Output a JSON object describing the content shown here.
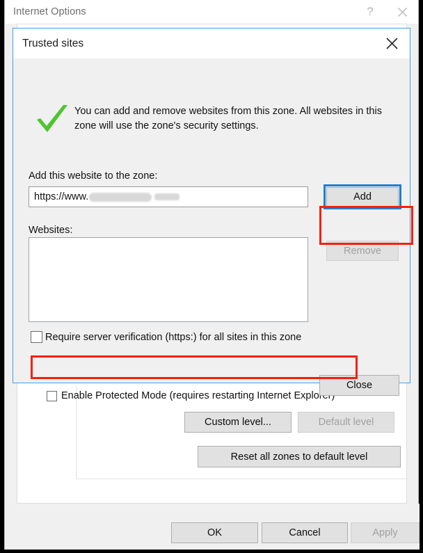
{
  "internet_options": {
    "title": "Internet Options",
    "titlebar_buttons": [
      {
        "name": "help-button",
        "glyph": "?"
      },
      {
        "name": "close-button",
        "glyph": "✕"
      }
    ],
    "protected_mode": {
      "label": "Enable Protected Mode (requires restarting Internet Explorer)",
      "checked": false
    },
    "buttons": {
      "custom_level": "Custom level...",
      "default_level": "Default level",
      "reset_zones": "Reset all zones to default level",
      "ok": "OK",
      "cancel": "Cancel",
      "apply": "Apply"
    },
    "disabled_buttons": [
      "Default level",
      "Apply"
    ]
  },
  "trusted_sites": {
    "title": "Trusted sites",
    "close_icon": "close-icon",
    "banner": {
      "icon": "green-checkmark-icon",
      "text": "You can add and remove websites from this zone. All websites in this zone will use the zone's security settings."
    },
    "add_website": {
      "label": "Add this website to the zone:",
      "value": "https://www.",
      "value_redacted": true,
      "placeholder": ""
    },
    "websites": {
      "label": "Websites:",
      "items": []
    },
    "buttons": {
      "add": "Add",
      "remove": "Remove",
      "close": "Close"
    },
    "disabled_buttons": [
      "Remove"
    ],
    "focused_button": "Add",
    "require_https": {
      "label": "Require server verification (https:) for all sites in this zone",
      "checked": false
    }
  },
  "annotations": {
    "color": "#f81f09",
    "highlights": [
      "add-button",
      "require-server-verification-checkbox"
    ]
  },
  "colors": {
    "accent_blue": "#3da0ef",
    "focus_blue": "#1f7fd4",
    "annotation_red": "#f81f09",
    "checkmark_green": "#4ec52e",
    "dialog_face": "#f0f0f0",
    "button_face": "#e1e1e1"
  }
}
